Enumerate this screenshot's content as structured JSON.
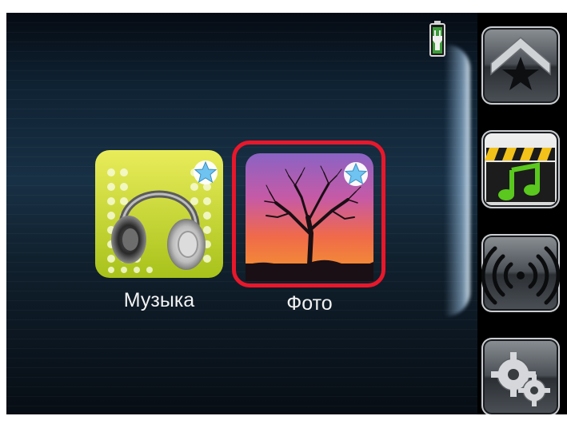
{
  "apps": [
    {
      "label": "Музыка",
      "icon": "headphones-icon",
      "favorite": true
    },
    {
      "label": "Фото",
      "icon": "tree-sunset-icon",
      "favorite": true,
      "selected": true
    }
  ],
  "sidebar": {
    "items": [
      {
        "icon": "favorites-star-icon"
      },
      {
        "icon": "media-music-icon",
        "active": true
      },
      {
        "icon": "radio-broadcast-icon"
      },
      {
        "icon": "settings-gears-icon"
      }
    ]
  },
  "status": {
    "battery_icon": "battery-charging-icon"
  },
  "colors": {
    "selection": "#e8172b",
    "favorite_star": "#6fc3f0"
  }
}
